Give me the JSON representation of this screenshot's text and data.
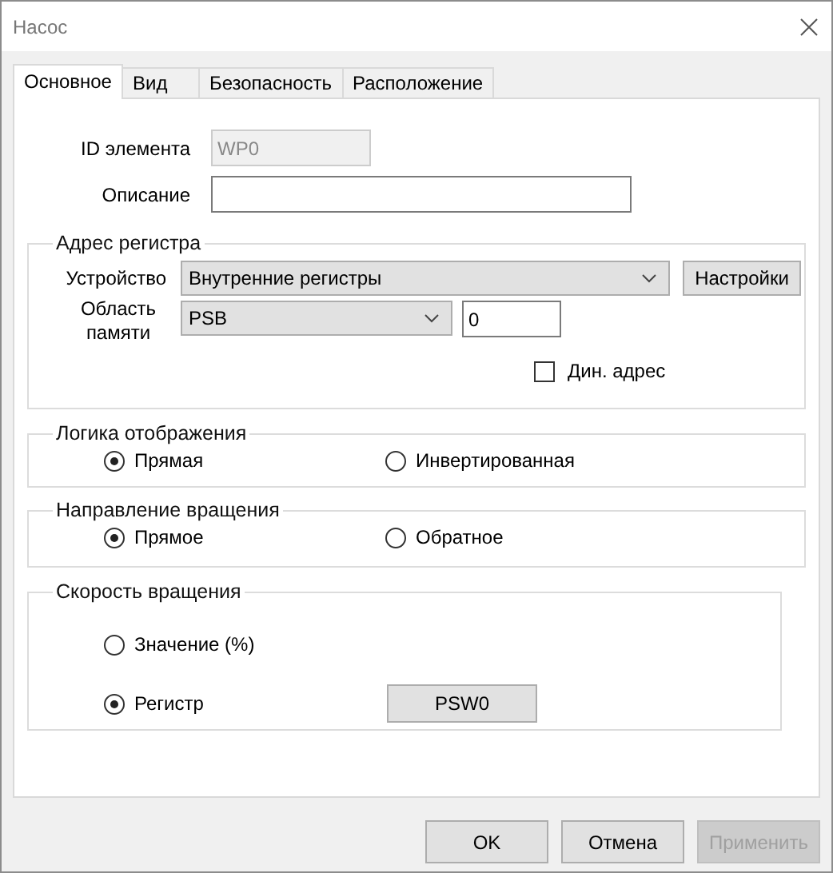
{
  "window": {
    "title": "Насос"
  },
  "tabs": [
    {
      "label": "Основное",
      "selected": true
    },
    {
      "label": "Вид",
      "selected": false
    },
    {
      "label": "Безопасность",
      "selected": false
    },
    {
      "label": "Расположение",
      "selected": false
    }
  ],
  "element_id": {
    "label": "ID элемента",
    "value": "WP0",
    "disabled": true
  },
  "description": {
    "label": "Описание"
  },
  "register_address": {
    "title": "Адрес регистра",
    "device": {
      "label": "Устройство",
      "value": "Внутренние регистры"
    },
    "settings_button": "Настройки",
    "memory_area": {
      "label": "Область памяти",
      "value": "PSB"
    },
    "address": "0",
    "dynamic_address": {
      "label": "Дин. адрес",
      "checked": false
    }
  },
  "display_logic": {
    "title": "Логика отображения",
    "options": [
      {
        "label": "Прямая",
        "selected": true
      },
      {
        "label": "Инвертированная",
        "selected": false
      }
    ]
  },
  "rotation_direction": {
    "title": "Направление вращения",
    "options": [
      {
        "label": "Прямое",
        "selected": true
      },
      {
        "label": "Обратное",
        "selected": false
      }
    ]
  },
  "rotation_speed": {
    "title": "Скорость вращения",
    "options": [
      {
        "label": "Значение (%)",
        "selected": false
      },
      {
        "label": "Регистр",
        "selected": true
      }
    ],
    "register_button": "PSW0"
  },
  "buttons": [
    {
      "label": "OK",
      "disabled": false
    },
    {
      "label": "Отмена",
      "disabled": false
    },
    {
      "label": "Применить",
      "disabled": true
    }
  ]
}
